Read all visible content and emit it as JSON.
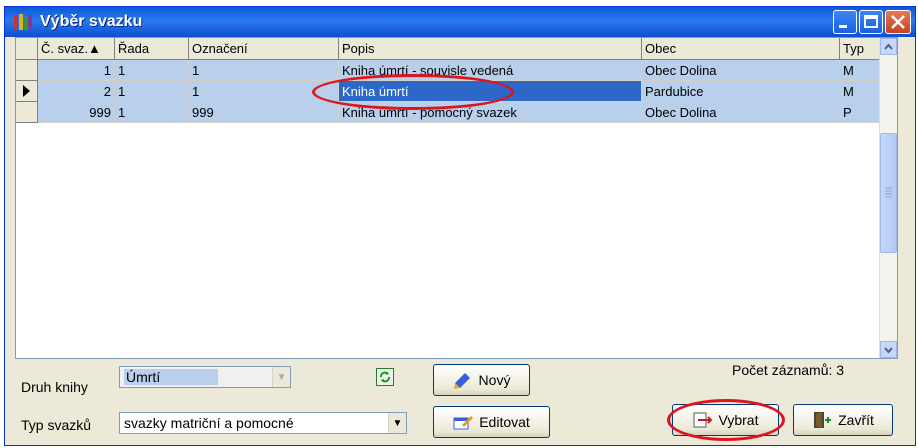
{
  "window": {
    "title": "Výběr svazku"
  },
  "grid": {
    "columns": [
      "Č. svaz.",
      "Řada",
      "Označení",
      "Popis",
      "Obec",
      "Typ"
    ],
    "sort_indicator": "▲",
    "rows": [
      {
        "cislo": "1",
        "rada": "1",
        "oznaceni": "1",
        "popis": "Kniha úmrtí - souvisle vedená",
        "obec": "Obec Dolina",
        "typ": "M"
      },
      {
        "cislo": "2",
        "rada": "1",
        "oznaceni": "1",
        "popis": "Kniha úmrtí",
        "obec": "Pardubice",
        "typ": "M"
      },
      {
        "cislo": "999",
        "rada": "1",
        "oznaceni": "999",
        "popis": "Kniha úmrtí - pomocný svazek",
        "obec": "Obec Dolina",
        "typ": "P"
      }
    ],
    "selected_row_index": 1
  },
  "form": {
    "druh_label": "Druh knihy",
    "druh_value": "Úmrtí",
    "typ_label": "Typ svazků",
    "typ_value": "svazky matriční a pomocné",
    "count_text": "Počet záznamů: 3"
  },
  "buttons": {
    "novy": "Nový",
    "editovat": "Editovat",
    "vybrat": "Vybrat",
    "zavrit": "Zavřít"
  },
  "colors": {
    "titlebar": "#0a5bd8",
    "row_bg": "#b8d0ec",
    "selected_cell": "#2d67c8",
    "highlight_ellipse": "#e0141c"
  }
}
